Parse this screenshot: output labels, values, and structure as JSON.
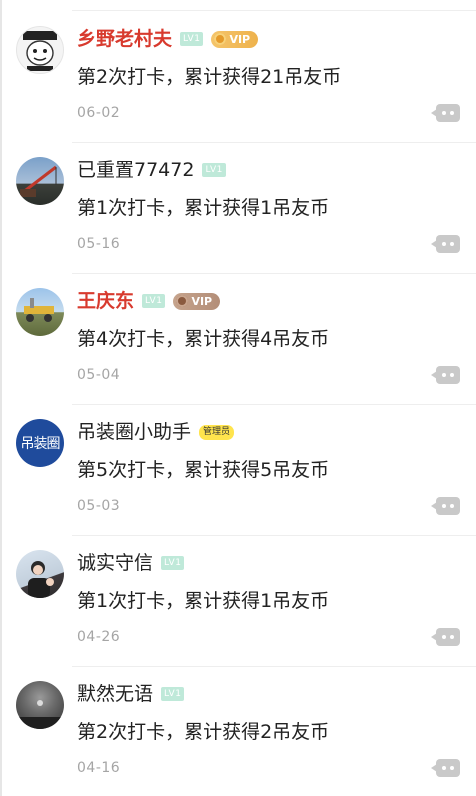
{
  "posts": [
    {
      "username": "乡野老村夫",
      "level": "LV1",
      "vip": "VIP",
      "content": "第2次打卡，累计获得21吊友币",
      "date": "06-02",
      "avatar": "cartoon-face-avatar"
    },
    {
      "username": "已重置77472",
      "level": "LV1",
      "content": "第1次打卡，累计获得1吊友币",
      "date": "05-16",
      "avatar": "crane-photo-avatar"
    },
    {
      "username": "王庆东",
      "level": "LV1",
      "vip": "VIP",
      "content": "第4次打卡，累计获得4吊友币",
      "date": "05-04",
      "avatar": "field-photo-avatar"
    },
    {
      "username": "吊装圈小助手",
      "admin_badge": "管理员",
      "content": "第5次打卡，累计获得5吊友币",
      "date": "05-03",
      "avatar": "logo-avatar",
      "avatar_text": "吊装圈"
    },
    {
      "username": "诚实守信",
      "level": "LV1",
      "content": "第1次打卡，累计获得1吊友币",
      "date": "04-26",
      "avatar": "person-photo-avatar"
    },
    {
      "username": "默然无语",
      "level": "LV1",
      "content": "第2次打卡，累计获得2吊友币",
      "date": "04-16",
      "avatar": "dark-photo-avatar"
    }
  ],
  "colors": {
    "vip_name": "#d83a2e",
    "level_badge": "#bfe9d9",
    "vip_gold": "#f0b95a",
    "vip_brown": "#bb9781",
    "admin_badge": "#ffe44d",
    "date_text": "#a5a5a5",
    "comment_icon": "#c9c9c9"
  },
  "icons": {
    "comment": "comment-bubble-icon"
  }
}
